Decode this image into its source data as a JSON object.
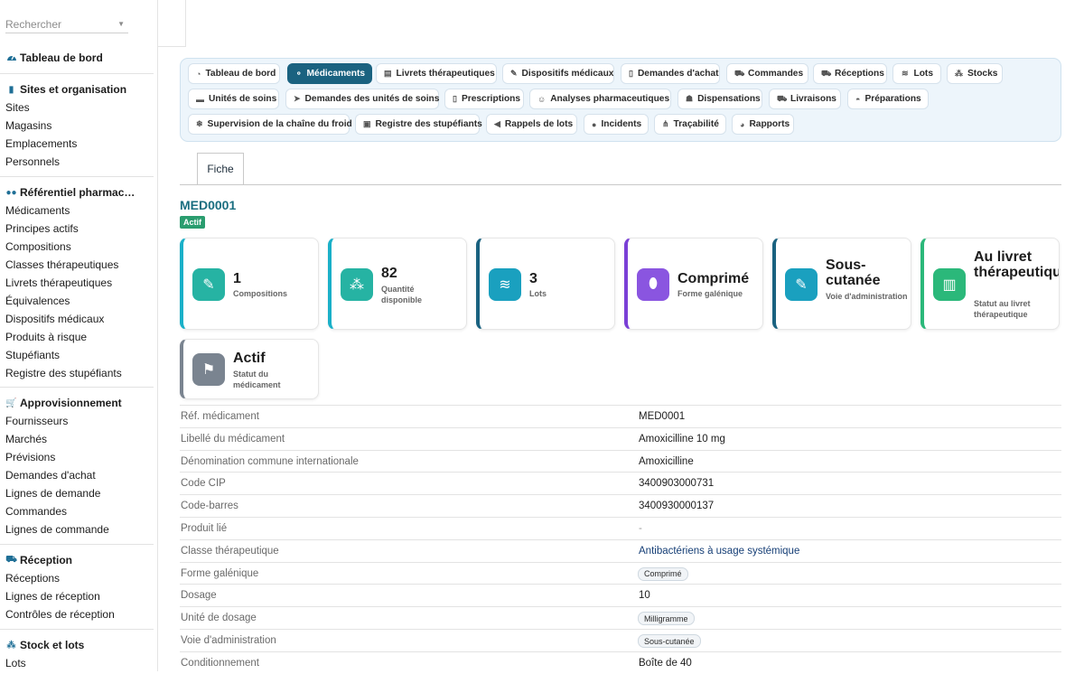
{
  "sidebar": {
    "search_placeholder": "Rechercher",
    "dashboard": "Tableau de bord",
    "groups": [
      {
        "title": "Sites et organisation",
        "icon": "building-icon",
        "items": [
          "Sites",
          "Magasins",
          "Emplacements",
          "Personnels"
        ]
      },
      {
        "title": "Référentiel pharmac…",
        "icon": "pills-icon",
        "items": [
          "Médicaments",
          "Principes actifs",
          "Compositions",
          "Classes thérapeutiques",
          "Livrets thérapeutiques",
          "Équivalences",
          "Dispositifs médicaux",
          "Produits à risque",
          "Stupéfiants",
          "Registre des stupéfiants"
        ]
      },
      {
        "title": "Approvisionnement",
        "icon": "cart-icon",
        "items": [
          "Fournisseurs",
          "Marchés",
          "Prévisions",
          "Demandes d'achat",
          "Lignes de demande",
          "Commandes",
          "Lignes de commande"
        ]
      },
      {
        "title": "Réception",
        "icon": "truck-loading-icon",
        "items": [
          "Réceptions",
          "Lignes de réception",
          "Contrôles de réception"
        ]
      },
      {
        "title": "Stock et lots",
        "icon": "cubes-icon",
        "items": [
          "Lots"
        ]
      }
    ]
  },
  "nav": {
    "tabs": [
      {
        "label": "Tableau de bord",
        "icon": "gauge-icon",
        "glyph": "◔"
      },
      {
        "label": "Médicaments",
        "icon": "pills-icon",
        "glyph": "⚬",
        "active": true
      },
      {
        "label": "Livrets thérapeutiques",
        "icon": "book-icon",
        "glyph": "▤"
      },
      {
        "label": "Dispositifs médicaux",
        "icon": "syringe-icon",
        "glyph": "✎"
      },
      {
        "label": "Demandes d'achat",
        "icon": "file-icon",
        "glyph": "▯"
      },
      {
        "label": "Commandes",
        "icon": "cart-icon",
        "glyph": "⛟"
      },
      {
        "label": "Réceptions",
        "icon": "truck-loading-icon",
        "glyph": "⛟"
      },
      {
        "label": "Lots",
        "icon": "layers-icon",
        "glyph": "≋"
      },
      {
        "label": "Stocks",
        "icon": "cubes-icon",
        "glyph": "⁂"
      },
      {
        "label": "Unités de soins",
        "icon": "bed-icon",
        "glyph": "▬"
      },
      {
        "label": "Demandes des unités de soins",
        "icon": "paper-plane-icon",
        "glyph": "➤"
      },
      {
        "label": "Prescriptions",
        "icon": "prescription-icon",
        "glyph": "▯"
      },
      {
        "label": "Analyses pharmaceutiques",
        "icon": "user-check-icon",
        "glyph": "☺"
      },
      {
        "label": "Dispensations",
        "icon": "hand-holding-icon",
        "glyph": "☗"
      },
      {
        "label": "Livraisons",
        "icon": "truck-icon",
        "glyph": "⛟"
      },
      {
        "label": "Préparations",
        "icon": "mortar-icon",
        "glyph": "◓"
      },
      {
        "label": "Supervision de la chaîne du froid",
        "icon": "snowflake-icon",
        "glyph": "❄"
      },
      {
        "label": "Registre des stupéfiants",
        "icon": "lock-icon",
        "glyph": "▣"
      },
      {
        "label": "Rappels de lots",
        "icon": "megaphone-icon",
        "glyph": "◀"
      },
      {
        "label": "Incidents",
        "icon": "alert-circle-icon",
        "glyph": "●"
      },
      {
        "label": "Traçabilité",
        "icon": "sitemap-icon",
        "glyph": "⋔"
      },
      {
        "label": "Rapports",
        "icon": "chart-pie-icon",
        "glyph": "◕"
      }
    ]
  },
  "detail": {
    "tab_label": "Fiche",
    "title": "MED0001",
    "status_badge": "Actif",
    "cards": [
      {
        "value": "1",
        "label": "Compositions",
        "icon": "pills-icon",
        "glyph": "✎",
        "accent": "#1ab0c8",
        "icon_bg": "#26b3a3"
      },
      {
        "value": "82",
        "label": "Quantité disponible",
        "icon": "cubes-icon",
        "glyph": "⁂",
        "accent": "#1ab0c8",
        "icon_bg": "#26b3a3"
      },
      {
        "value": "3",
        "label": "Lots",
        "icon": "layers-icon",
        "glyph": "≋",
        "accent": "#1a6280",
        "icon_bg": "#1aa0bf"
      },
      {
        "value": "Comprimé",
        "label": "Forme galénique",
        "icon": "capsule-icon",
        "glyph": "⬮",
        "accent": "#7a3fd6",
        "icon_bg": "#8a55e0"
      },
      {
        "value": "Sous-cutanée",
        "label": "Voie d'administration",
        "icon": "syringe-icon",
        "glyph": "✎",
        "accent": "#1a6280",
        "icon_bg": "#1aa0bf"
      },
      {
        "value": "Au livret thérapeutique",
        "label": "Statut au livret thérapeutique",
        "icon": "book-open-icon",
        "glyph": "▥",
        "accent": "#2bb87a",
        "icon_bg": "#2bb87a"
      },
      {
        "value": "Actif",
        "label": "Statut du médicament",
        "icon": "flag-icon",
        "glyph": "⚑",
        "accent": "#7a8490",
        "icon_bg": "#7a8490"
      }
    ],
    "fields": [
      {
        "key": "Réf. médicament",
        "value": "MED0001",
        "kind": "text"
      },
      {
        "key": "Libellé du médicament",
        "value": "Amoxicilline 10 mg",
        "kind": "text"
      },
      {
        "key": "Dénomination commune internationale",
        "value": "Amoxicilline",
        "kind": "text"
      },
      {
        "key": "Code CIP",
        "value": "3400903000731",
        "kind": "text"
      },
      {
        "key": "Code-barres",
        "value": "3400930000137",
        "kind": "text"
      },
      {
        "key": "Produit lié",
        "value": "-",
        "kind": "muted"
      },
      {
        "key": "Classe thérapeutique",
        "value": "Antibactériens à usage systémique",
        "kind": "link"
      },
      {
        "key": "Forme galénique",
        "value": "Comprimé",
        "kind": "pill"
      },
      {
        "key": "Dosage",
        "value": "10",
        "kind": "text"
      },
      {
        "key": "Unité de dosage",
        "value": "Milligramme",
        "kind": "pill"
      },
      {
        "key": "Voie d'administration",
        "value": "Sous-cutanée",
        "kind": "pill"
      },
      {
        "key": "Conditionnement",
        "value": "Boîte de 40",
        "kind": "text"
      }
    ]
  }
}
